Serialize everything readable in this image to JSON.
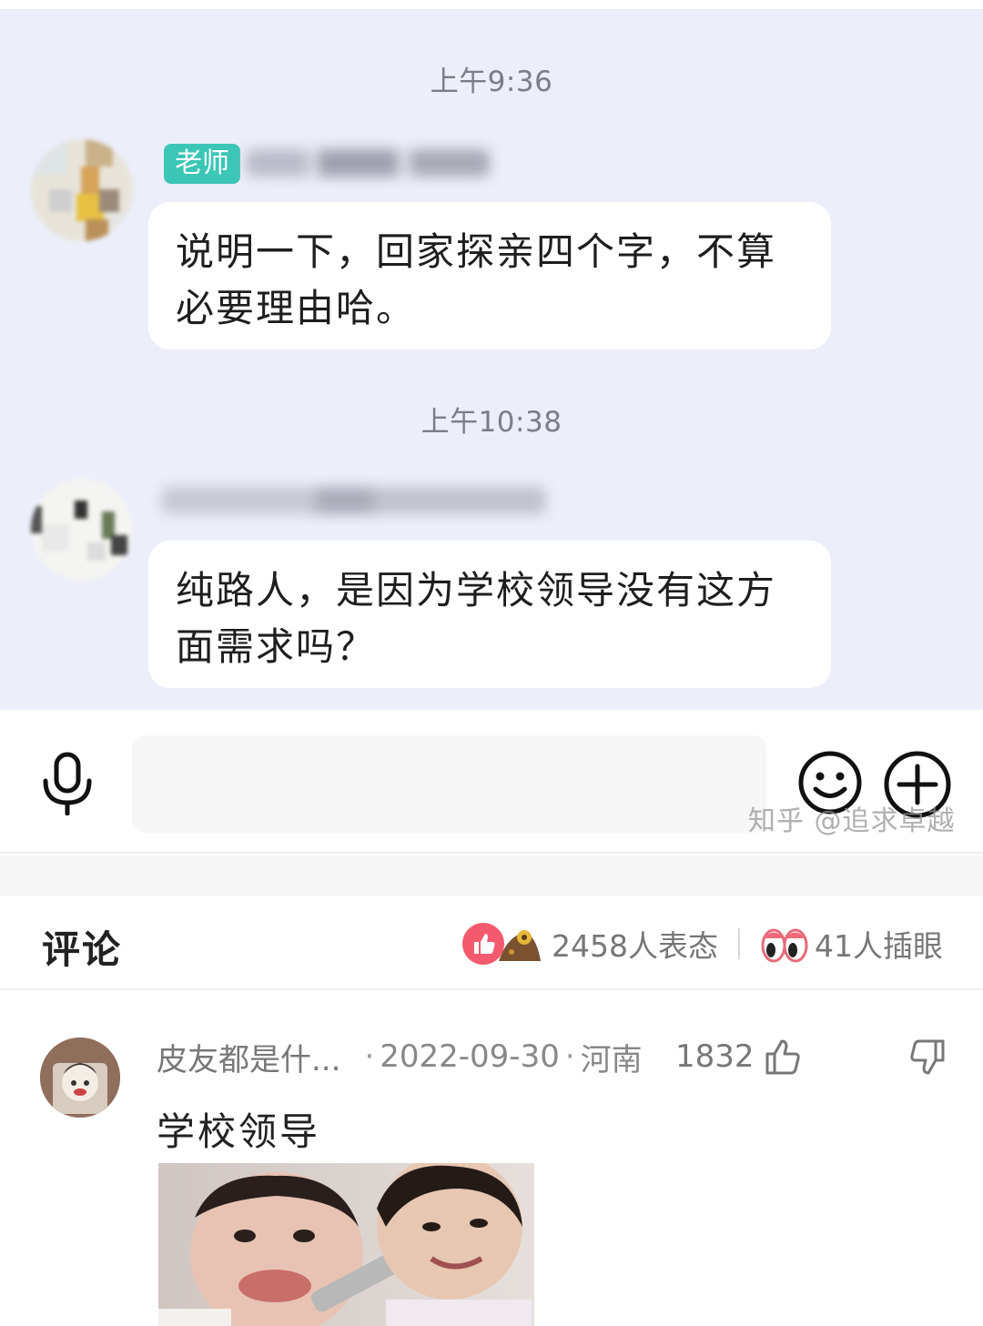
{
  "chat": {
    "messages": [
      {
        "time": "上午9:36",
        "role_tag": "老师",
        "text_line1": "说明一下，回家探亲四个字，不算",
        "text_line2": "必要理由哈。"
      },
      {
        "time": "上午10:38",
        "text_line1": "纯路人，是因为学校领导没有这方",
        "text_line2": "面需求吗？"
      }
    ]
  },
  "input_bar": {
    "icons": [
      "microphone-icon",
      "emoji-icon",
      "plus-icon"
    ]
  },
  "watermark": "知乎 @追求卓越",
  "comments_header": {
    "title": "评论",
    "reactions_count": "2458人表态",
    "peek_count": "41人插眼"
  },
  "comment": {
    "author": "皮友都是什...",
    "date": "2022-09-30",
    "location": "河南",
    "likes": "1832",
    "text": "学校领导"
  },
  "colors": {
    "chat_background": "#eceef9",
    "teacher_tag": "#3cc6b6",
    "like_badge": "#f35a6e"
  }
}
